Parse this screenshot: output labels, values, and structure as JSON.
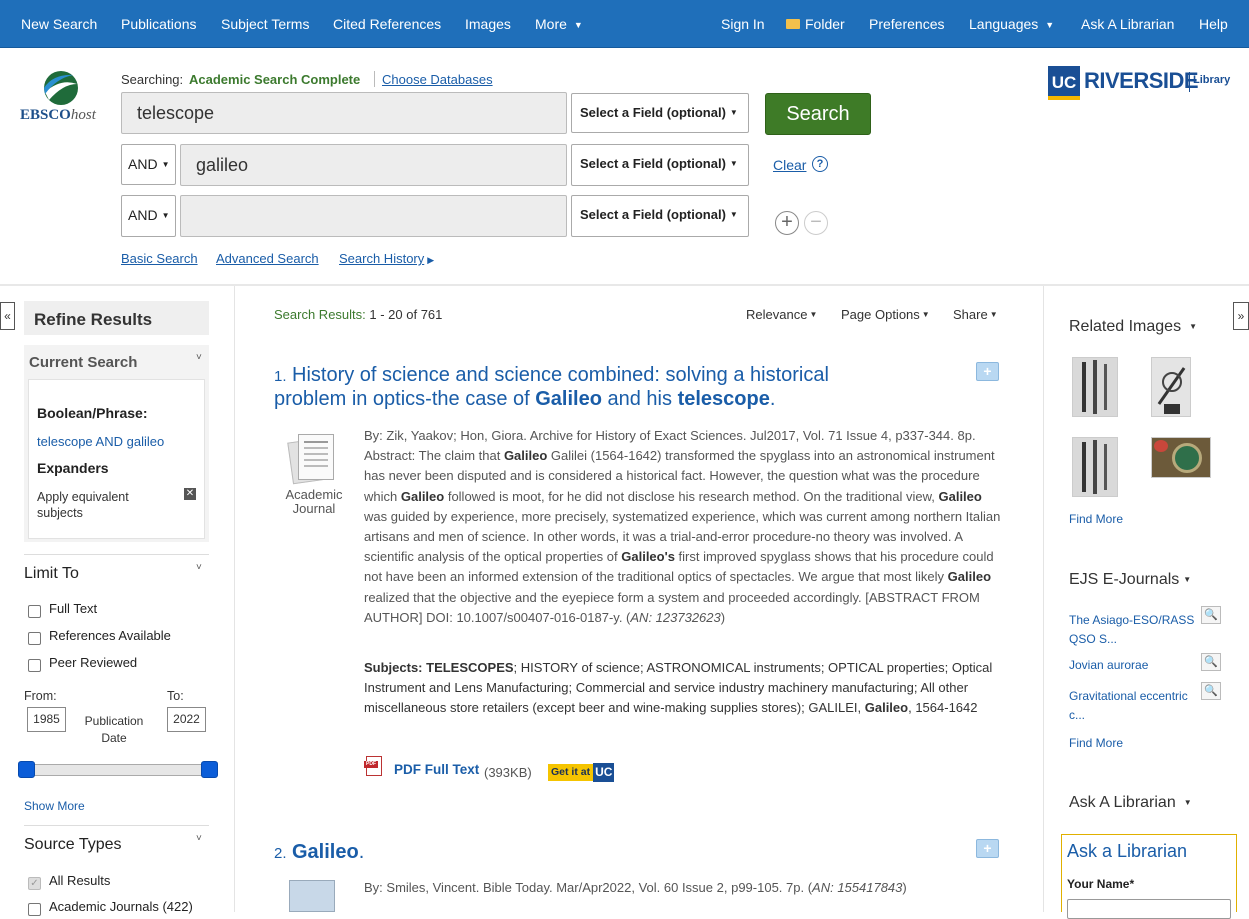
{
  "topnav": {
    "left": [
      "New Search",
      "Publications",
      "Subject Terms",
      "Cited References",
      "Images",
      "More"
    ],
    "right": [
      "Sign In",
      "Folder",
      "Preferences",
      "Languages",
      "Ask A Librarian",
      "Help"
    ]
  },
  "brand": {
    "logo_main": "EBSCO",
    "logo_sub": "host",
    "uc_logo": "UC",
    "uc_name": "RIVERSIDE",
    "uc_tag": "Library"
  },
  "search": {
    "searching_label": "Searching:",
    "database": "Academic Search Complete",
    "choose_db": "Choose Databases",
    "field_placeholder": "Select a Field (optional)",
    "rows": [
      {
        "op": "",
        "term": "telescope"
      },
      {
        "op": "AND",
        "term": "galileo"
      },
      {
        "op": "AND",
        "term": ""
      }
    ],
    "search_button": "Search",
    "clear": "Clear",
    "help": "?",
    "links": [
      "Basic Search",
      "Advanced Search",
      "Search History"
    ]
  },
  "refine": {
    "title": "Refine Results",
    "current_search": "Current Search",
    "boolean_label": "Boolean/Phrase:",
    "boolean_value": "telescope AND galileo",
    "expanders_label": "Expanders",
    "expander_value": "Apply equivalent subjects",
    "limit_to": "Limit To",
    "limits": [
      "Full Text",
      "References Available",
      "Peer Reviewed"
    ],
    "from_label": "From:",
    "to_label": "To:",
    "from_year": "1985",
    "to_year": "2022",
    "pub_date": "Publication Date",
    "show_more": "Show More",
    "source_types": "Source Types",
    "sources": [
      "All Results",
      "Academic Journals (422)"
    ]
  },
  "results": {
    "label": "Search Results:",
    "range": "1 - 20 of 761",
    "sort": "Relevance",
    "page_options": "Page Options",
    "share": "Share",
    "items": [
      {
        "num": "1.",
        "title_html": "History of science and science combined: solving a historical problem in optics-the case of <b>Galileo</b> and his <b>telescope</b>.",
        "type": "Academic Journal",
        "meta_html": "By: Zik, Yaakov; Hon, Giora. Archive for History of Exact Sciences. Jul2017, Vol. 71 Issue 4, p337-344. 8p.<br>Abstract: The claim that <b>Galileo</b> Galilei (1564-1642) transformed the spyglass into an astronomical instrument has never been disputed and is considered a historical fact. However, the question what was the procedure which <b>Galileo</b> followed is moot, for he did not disclose his research method. On the traditional view, <b>Galileo</b> was guided by experience, more precisely, systematized experience, which was current among northern Italian artisans and men of science. In other words, it was a trial-and-error procedure-no theory was involved. A scientific analysis of the optical properties of <b>Galileo's</b> first improved spyglass shows that his procedure could not have been an informed extension of the traditional optics of spectacles. We argue that most likely <b>Galileo</b> realized that the objective and the eyepiece form a system and proceeded accordingly. [ABSTRACT FROM AUTHOR] DOI: 10.1007/s00407-016-0187-y. (<i>AN: 123732623</i>)",
        "subjects_html": "<b>Subjects: TELESCOPES</b>; HISTORY of science; ASTRONOMICAL instruments; OPTICAL properties; Optical Instrument and Lens Manufacturing; Commercial and service industry machinery manufacturing; All other miscellaneous store retailers (except beer and wine-making supplies stores); GALILEI, <b>Galileo</b>, 1564-1642",
        "pdf": "PDF Full Text",
        "pdf_size": "(393KB)",
        "getit": "Get it at",
        "getit_uc": "UC"
      },
      {
        "num": "2.",
        "title_html": "<b>Galileo</b>.",
        "meta_html": "By: Smiles, Vincent. Bible Today. Mar/Apr2022, Vol. 60 Issue 2, p99-105. 7p. (<i>AN: 155417843</i>)"
      }
    ]
  },
  "right": {
    "related_images": "Related Images",
    "find_more": "Find More",
    "ejs": "EJS E-Journals",
    "journals": [
      "The Asiago-ESO/RASS QSO S...",
      "Jovian aurorae",
      "Gravitational eccentric c..."
    ],
    "ask": "Ask A Librarian",
    "ask_box_title": "Ask a Librarian",
    "your_name": "Your Name*"
  },
  "colors": {
    "nav": "#1f6fba",
    "search_btn": "#3e7b27",
    "link": "#1a5da8",
    "db_green": "#3c7a2e"
  }
}
